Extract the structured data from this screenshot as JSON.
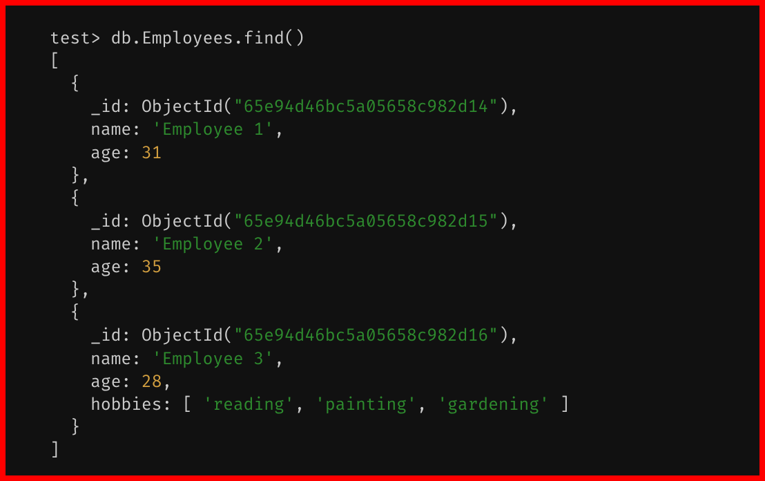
{
  "prompt": "test>",
  "command": "db.Employees.find()",
  "brackets": {
    "arr_open": "[",
    "arr_close": "]",
    "obj_open": "  {",
    "obj_close": "  },",
    "obj_close_last": "  }",
    "sq_open": "[",
    "sq_close": "]"
  },
  "keys": {
    "id": "_id:",
    "name": "name:",
    "age": "age:",
    "hobbies": "hobbies:"
  },
  "fn": {
    "objectid": "ObjectId(",
    "close": ")"
  },
  "punct": {
    "comma": ",",
    "quote": "\"",
    "space": " ",
    "sep": ", "
  },
  "records": [
    {
      "id": "\"65e94d46bc5a05658c982d14\"",
      "name": "'Employee 1'",
      "age": "31"
    },
    {
      "id": "\"65e94d46bc5a05658c982d15\"",
      "name": "'Employee 2'",
      "age": "35"
    },
    {
      "id": "\"65e94d46bc5a05658c982d16\"",
      "name": "'Employee 3'",
      "age": "28",
      "hobbies": [
        "'reading'",
        "'painting'",
        "'gardening'"
      ]
    }
  ],
  "indent": {
    "i1": "    ",
    "i0": "  "
  }
}
